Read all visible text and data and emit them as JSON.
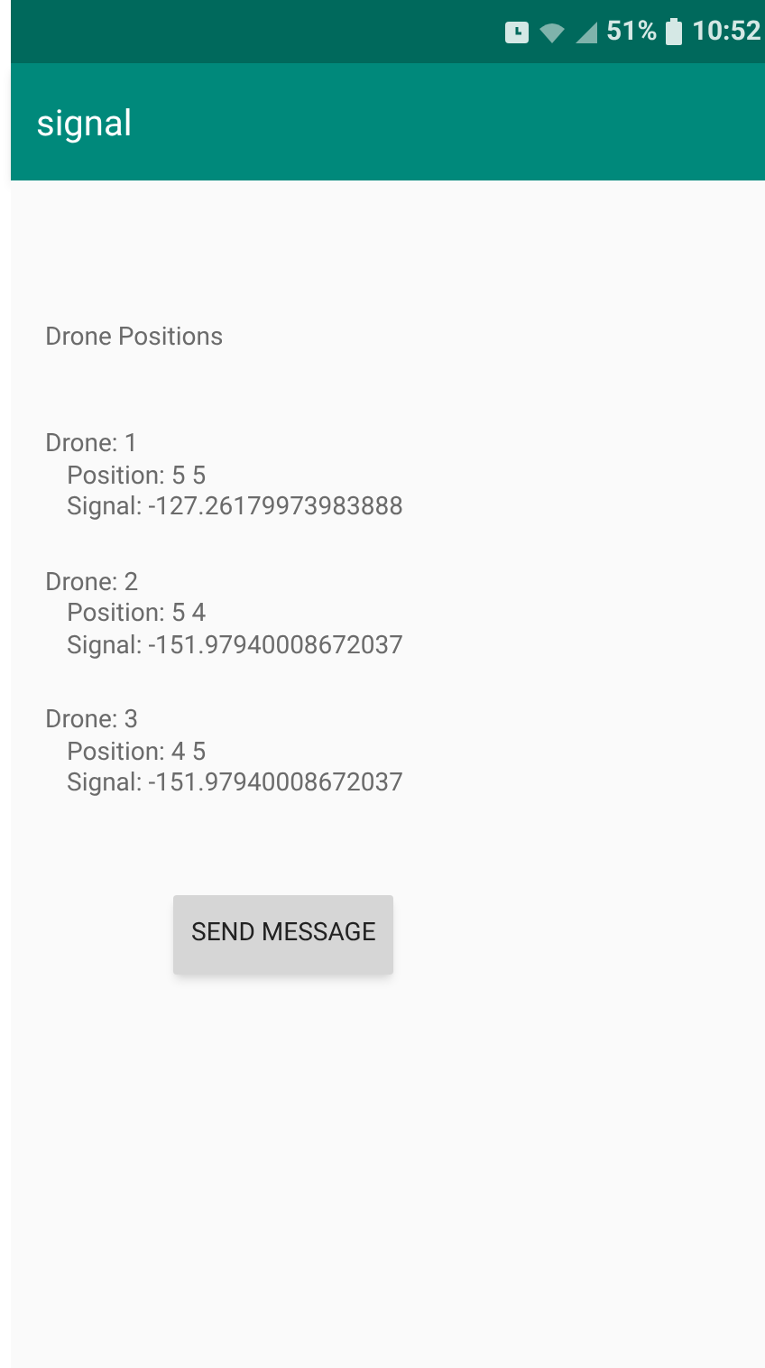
{
  "status_bar": {
    "battery": "51%",
    "time": "10:52"
  },
  "app_bar": {
    "title": "signal"
  },
  "heading": "Drone Positions",
  "drones": [
    {
      "drone": "Drone: 1",
      "position": "Position: 5 5",
      "signal": "Signal: -127.26179973983888"
    },
    {
      "drone": "Drone: 2",
      "position": "Position: 5 4",
      "signal": "Signal: -151.97940008672037"
    },
    {
      "drone": "Drone: 3",
      "position": "Position: 4 5",
      "signal": "Signal: -151.97940008672037"
    }
  ],
  "button": "SEND MESSAGE"
}
